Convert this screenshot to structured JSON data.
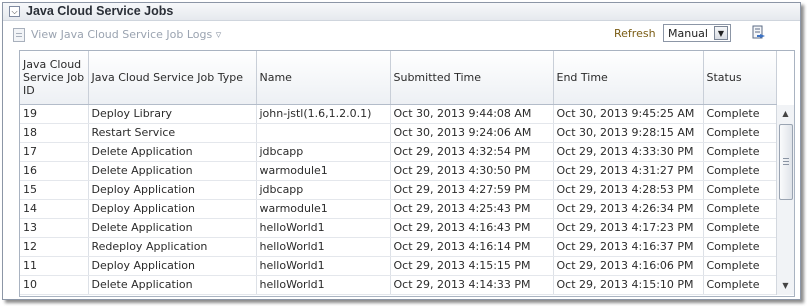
{
  "panel": {
    "title": "Java Cloud Service Jobs",
    "collapse_icon": "chevron-down-icon"
  },
  "toolbar": {
    "view_logs_label": "View Java Cloud Service Job Logs",
    "view_logs_arrow": "▿",
    "refresh_label": "Refresh",
    "refresh_value": "Manual",
    "export_icon": "export-icon"
  },
  "table": {
    "columns": [
      "Java Cloud Service Job ID",
      "Java Cloud Service Job Type",
      "Name",
      "Submitted Time",
      "End Time",
      "Status"
    ],
    "rows": [
      [
        "19",
        "Deploy Library",
        "john-jstl(1.6,1.2.0.1)",
        "Oct 30, 2013 9:44:08 AM",
        "Oct 30, 2013 9:45:25 AM",
        "Complete"
      ],
      [
        "18",
        "Restart Service",
        "",
        "Oct 30, 2013 9:24:06 AM",
        "Oct 30, 2013 9:28:15 AM",
        "Complete"
      ],
      [
        "17",
        "Delete Application",
        "jdbcapp",
        "Oct 29, 2013 4:32:54 PM",
        "Oct 29, 2013 4:33:30 PM",
        "Complete"
      ],
      [
        "16",
        "Delete Application",
        "warmodule1",
        "Oct 29, 2013 4:30:50 PM",
        "Oct 29, 2013 4:31:27 PM",
        "Complete"
      ],
      [
        "15",
        "Deploy Application",
        "jdbcapp",
        "Oct 29, 2013 4:27:59 PM",
        "Oct 29, 2013 4:28:53 PM",
        "Complete"
      ],
      [
        "14",
        "Deploy Application",
        "warmodule1",
        "Oct 29, 2013 4:25:43 PM",
        "Oct 29, 2013 4:26:34 PM",
        "Complete"
      ],
      [
        "13",
        "Delete Application",
        "helloWorld1",
        "Oct 29, 2013 4:16:43 PM",
        "Oct 29, 2013 4:17:23 PM",
        "Complete"
      ],
      [
        "12",
        "Redeploy Application",
        "helloWorld1",
        "Oct 29, 2013 4:16:14 PM",
        "Oct 29, 2013 4:16:37 PM",
        "Complete"
      ],
      [
        "11",
        "Deploy Application",
        "helloWorld1",
        "Oct 29, 2013 4:15:15 PM",
        "Oct 29, 2013 4:16:06 PM",
        "Complete"
      ],
      [
        "10",
        "Delete Application",
        "helloWorld1",
        "Oct 29, 2013 4:14:33 PM",
        "Oct 29, 2013 4:15:10 PM",
        "Complete"
      ]
    ]
  },
  "colors": {
    "header_bg": "#e6e9ee",
    "refresh_label": "#7a5c14",
    "disabled_link": "#9aa3b0"
  }
}
